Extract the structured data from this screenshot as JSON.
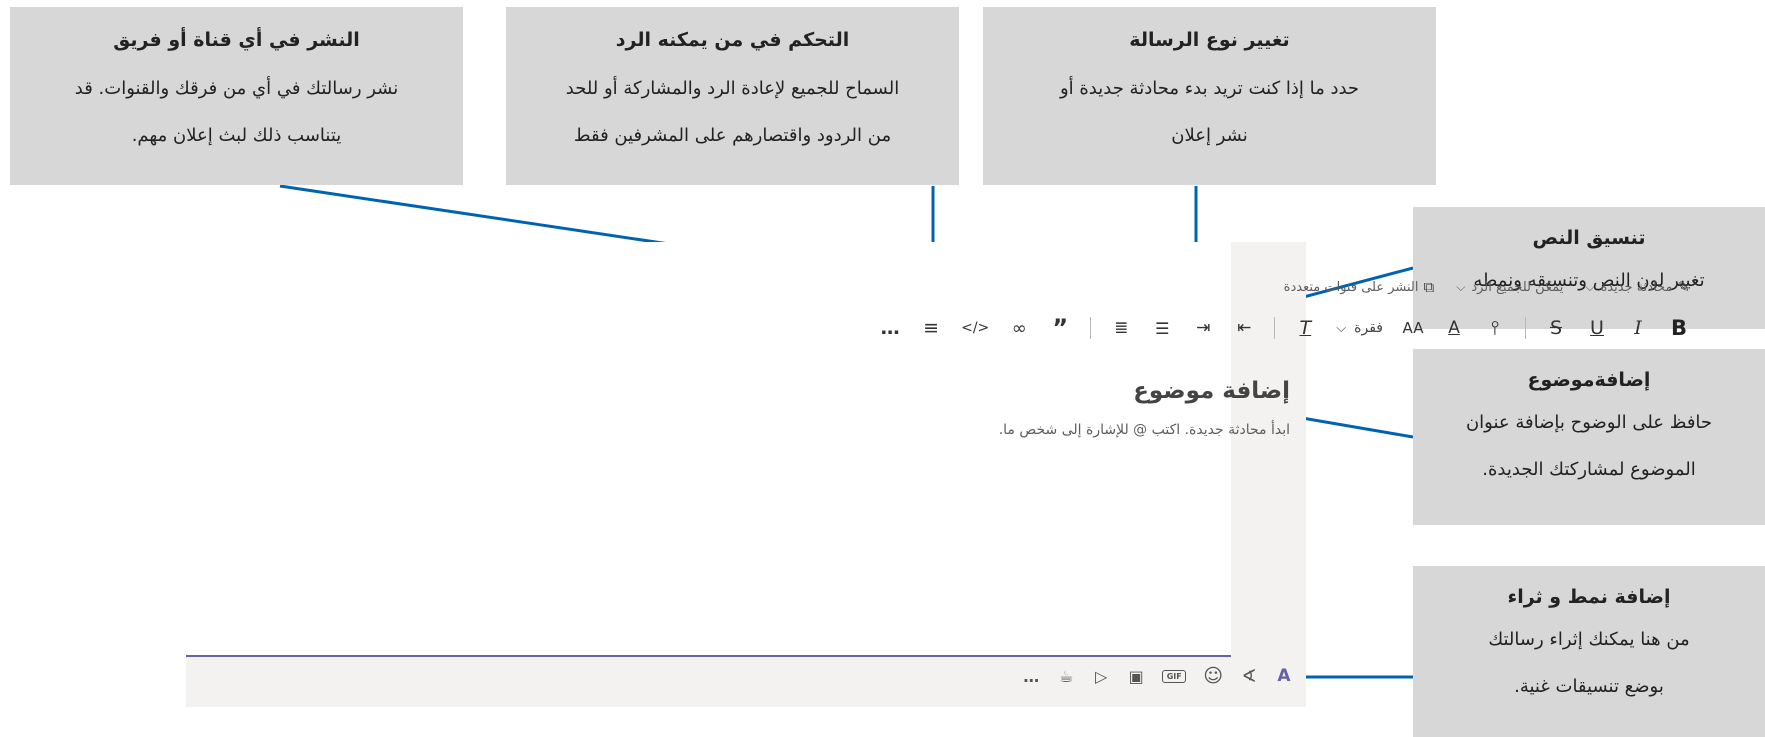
{
  "callouts": {
    "post": {
      "title": "النشر في أي قناة أو فريق",
      "line1": "نشر رسالتك في أي من فرقك والقنوات. قد",
      "line2": "يتناسب ذلك لبث إعلان مهم."
    },
    "control": {
      "title": "التحكم في من يمكنه الرد",
      "line1": "السماح للجميع لإعادة الرد والمشاركة أو للحد",
      "line2": "من الردود واقتصارهم على المشرفين فقط"
    },
    "type": {
      "title": "تغيير نوع الرسالة",
      "line1": "حدد ما إذا كنت تريد بدء محادثة جديدة أو",
      "line2": "نشر إعلان"
    },
    "format": {
      "title": "تنسيق النص",
      "line1": "تغيير لون النص وتنسيقه ونمطه"
    },
    "subject": {
      "title": "إضافةموضوع",
      "line1": "حافظ على الوضوح بإضافة عنوان",
      "line2": "الموضوع لمشاركتك الجديدة."
    },
    "rich": {
      "title": "إضافة نمط و ثراء",
      "line1": "من هنا يمكنك إثراء رسالتك",
      "line2": "بوضع تنسيقات غنية."
    }
  },
  "composer": {
    "meta": {
      "type_label": "محادثة جديدة",
      "reply_label": "يمكن للجميع الرد",
      "multi_label": "النشر على قنوات متعددة"
    },
    "format_bar": {
      "bold": "B",
      "italic": "I",
      "underline": "U",
      "strike": "S",
      "highlight": "⫯",
      "font_color": "A",
      "font_size": "AA",
      "paragraph": "فقرة",
      "clear": "T",
      "outdent": "⇤",
      "indent": "⇥",
      "bullets": "☰",
      "numbered": "≣",
      "quote": "”",
      "link": "∞",
      "code": "</>",
      "align": "≡",
      "more": "…"
    },
    "subject": "إضافة موضوع",
    "hint": "ابدأ محادثة جديدة. اكتب @ للإشارة إلى شخص ما.",
    "bottom_bar": {
      "format": "A",
      "attach": "∢",
      "emoji": "☺",
      "gif": "GIF",
      "sticker": "▣",
      "meet": "▷",
      "praise": "☕",
      "more": "…"
    }
  },
  "colors": {
    "accent": "#0063b1",
    "callout_bg": "#d7d7d7",
    "composer_bg": "#f3f2f1",
    "underline": "#6264a7"
  }
}
